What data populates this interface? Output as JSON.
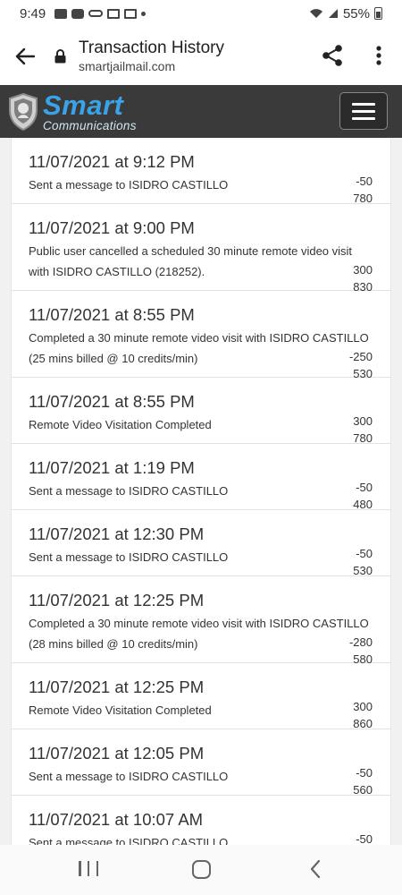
{
  "status_bar": {
    "time": "9:49",
    "battery": "55%",
    "icons": [
      "message-icon",
      "youtube-icon",
      "voicemail-icon",
      "gmail-icon",
      "gmail-icon",
      "dot-icon",
      "wifi-icon",
      "signal-icon",
      "battery-icon"
    ]
  },
  "browser": {
    "title": "Transaction History",
    "domain": "smartjailmail.com"
  },
  "site": {
    "logo_big": "Smart",
    "logo_small": "Communications",
    "brand_color": "#3aa3e6",
    "header_bg": "#3a3a3a"
  },
  "transactions": [
    {
      "date": "11/07/2021 at 9:12 PM",
      "desc": [
        "Sent a message to ISIDRO CASTILLO"
      ],
      "amount": "-50",
      "balance": "780"
    },
    {
      "date": "11/07/2021 at 9:00 PM",
      "desc": [
        "Public user cancelled a scheduled 30 minute remote video visit",
        "with ISIDRO CASTILLO (218252)."
      ],
      "amount": "300",
      "balance": "830"
    },
    {
      "date": "11/07/2021 at 8:55 PM",
      "desc": [
        "Completed a 30 minute remote video visit with ISIDRO CASTILLO",
        "(25 mins billed @ 10 credits/min)"
      ],
      "amount": "-250",
      "balance": "530"
    },
    {
      "date": "11/07/2021 at 8:55 PM",
      "desc": [
        "Remote Video Visitation Completed"
      ],
      "amount": "300",
      "balance": "780"
    },
    {
      "date": "11/07/2021 at 1:19 PM",
      "desc": [
        "Sent a message to ISIDRO CASTILLO"
      ],
      "amount": "-50",
      "balance": "480"
    },
    {
      "date": "11/07/2021 at 12:30 PM",
      "desc": [
        "Sent a message to ISIDRO CASTILLO"
      ],
      "amount": "-50",
      "balance": "530"
    },
    {
      "date": "11/07/2021 at 12:25 PM",
      "desc": [
        "Completed a 30 minute remote video visit with ISIDRO CASTILLO",
        "(28 mins billed @ 10 credits/min)"
      ],
      "amount": "-280",
      "balance": "580"
    },
    {
      "date": "11/07/2021 at 12:25 PM",
      "desc": [
        "Remote Video Visitation Completed"
      ],
      "amount": "300",
      "balance": "860"
    },
    {
      "date": "11/07/2021 at 12:05 PM",
      "desc": [
        "Sent a message to ISIDRO CASTILLO"
      ],
      "amount": "-50",
      "balance": "560"
    },
    {
      "date": "11/07/2021 at 10:07 AM",
      "desc": [
        "Sent a message to ISIDRO CASTILLO"
      ],
      "amount": "-50",
      "balance": ""
    }
  ]
}
